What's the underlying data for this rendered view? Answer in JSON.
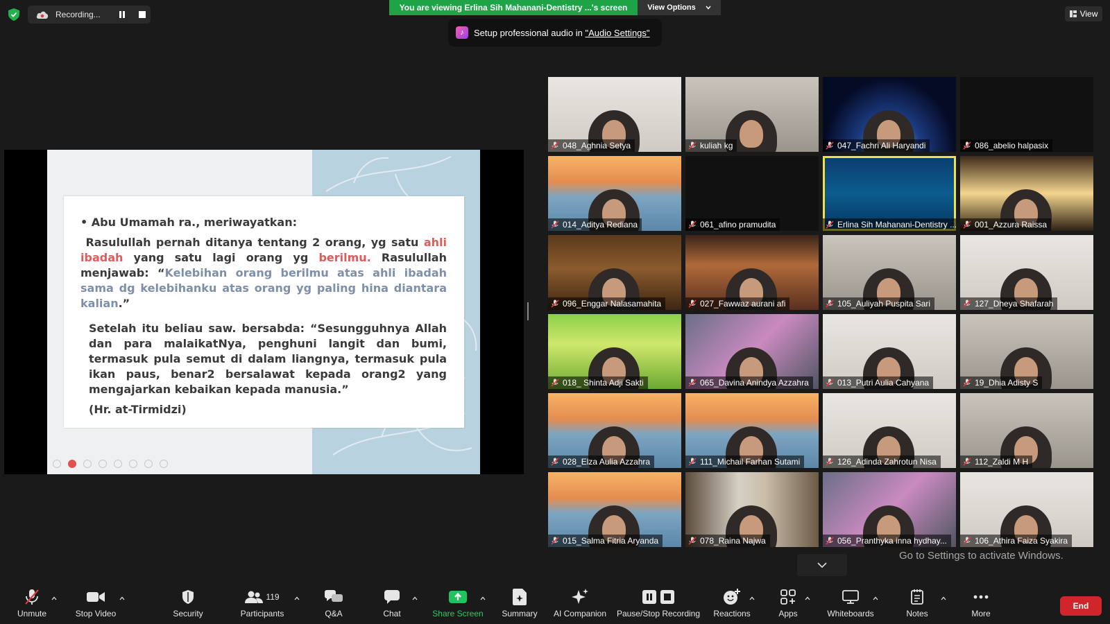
{
  "top": {
    "recording_label": "Recording...",
    "viewing_banner": "You are viewing Erlina Sih Mahanani-Dentistry ...'s screen",
    "view_options": "View Options",
    "audio_tip_prefix": "Setup professional audio in ",
    "audio_tip_link": "\"Audio Settings\"",
    "view_button": "View"
  },
  "slide": {
    "heading": "• Abu Umamah ra., meriwayatkan:",
    "p1_a": "Rasulullah pernah ditanya tentang 2 orang, yg satu ",
    "p1_red1": "ahli ibadah",
    "p1_b": " yang satu lagi orang yg ",
    "p1_red2": "berilmu.",
    "p1_c": " Rasulullah menjawab: “",
    "p1_blue": "Kelebihan orang berilmu atas ahli ibadah sama dg kelebihanku atas orang yg paling hina diantara kalian",
    "p1_d": ".”",
    "p2": "Setelah itu beliau saw. bersabda: “Sesungguhnya Allah dan para malaikatNya, penghuni langit dan bumi, termasuk pula semut di dalam liangnya, termasuk pula ikan paus, benar2 bersalawat kepada orang2 yang mengajarkan kebaikan kepada manusia.”",
    "source": "(Hr. at-Tirmidzi)"
  },
  "participants": [
    {
      "name": "048_Aghnia Setya",
      "bg": "bg-wall"
    },
    {
      "name": "kuliah kg",
      "bg": "bg-room"
    },
    {
      "name": "047_Fachri Ali Haryandi",
      "bg": "bg-space"
    },
    {
      "name": "086_abelio halpasix",
      "bg": "bg-dark"
    },
    {
      "name": "014_Aditya Rediana",
      "bg": "bg-golden"
    },
    {
      "name": "061_afino pramudita",
      "bg": "bg-dark"
    },
    {
      "name": "Erlina Sih Mahanani-Dentistry ...",
      "bg": "conf"
    },
    {
      "name": "001_Azzura Raissa",
      "bg": "bg-warm"
    },
    {
      "name": "096_Enggar Nalasamahita",
      "bg": "bg-library"
    },
    {
      "name": "027_Fawwaz aurani afi",
      "bg": "bg-hall"
    },
    {
      "name": "105_Auliyah Puspita Sari",
      "bg": "bg-room"
    },
    {
      "name": "127_Dheya Shafarah",
      "bg": "bg-wall"
    },
    {
      "name": "018_ Shinta Adji Sakti",
      "bg": "bg-grass"
    },
    {
      "name": "065_Davina Anindya Azzahra",
      "bg": "bg-pink"
    },
    {
      "name": "013_Putri Aulia Cahyana",
      "bg": "bg-wall"
    },
    {
      "name": "19_Dhia Adisty S",
      "bg": "bg-room"
    },
    {
      "name": "028_Elza Aulia Azzahra",
      "bg": "bg-golden"
    },
    {
      "name": "111_Michail Farhan Sutami",
      "bg": "bg-golden"
    },
    {
      "name": "126_Adinda Zahrotun Nisa",
      "bg": "bg-wall"
    },
    {
      "name": "112_Zaldi M H",
      "bg": "bg-room"
    },
    {
      "name": "015_Salma Fitria Aryanda",
      "bg": "bg-golden"
    },
    {
      "name": "078_Raina Najwa",
      "bg": "bg-curtain"
    },
    {
      "name": "056_Pranthyka inna hydhay...",
      "bg": "bg-pink"
    },
    {
      "name": "106_Athira Faiza Syakira",
      "bg": "bg-wall"
    }
  ],
  "watermark": "Go to Settings to activate Windows.",
  "toolbar": {
    "unmute": "Unmute",
    "stop_video": "Stop Video",
    "security": "Security",
    "participants": "Participants",
    "participant_count": "119",
    "qa": "Q&A",
    "chat": "Chat",
    "share_screen": "Share Screen",
    "summary": "Summary",
    "ai_companion": "AI Companion",
    "pause_stop_recording": "Pause/Stop Recording",
    "reactions": "Reactions",
    "apps": "Apps",
    "whiteboards": "Whiteboards",
    "notes": "Notes",
    "more": "More",
    "end": "End"
  }
}
